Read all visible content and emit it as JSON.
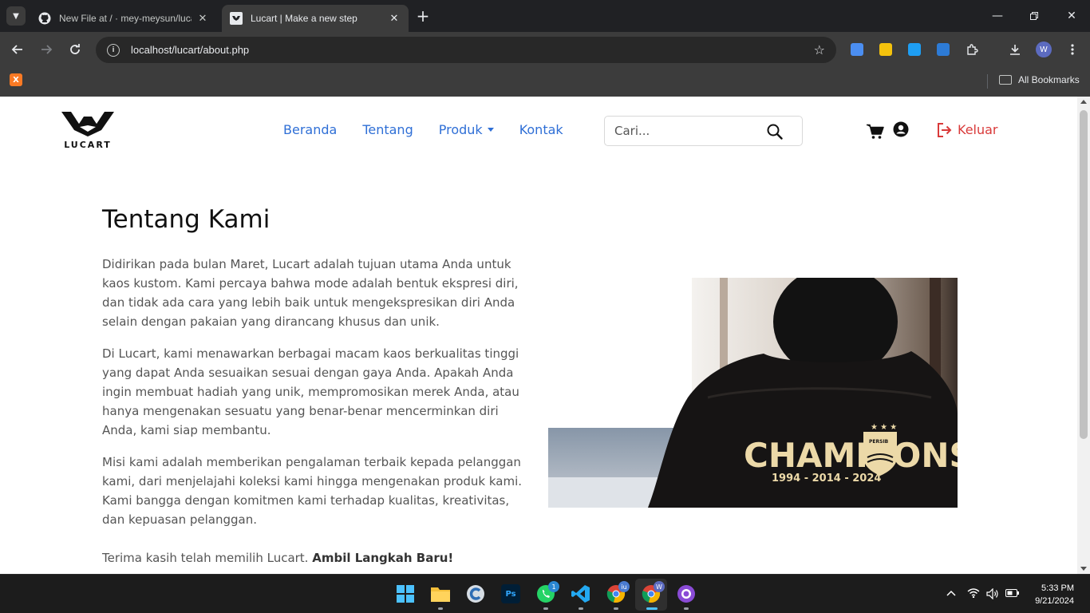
{
  "browser": {
    "tabs": [
      {
        "title": "New File at / · mey-meysun/lucart",
        "active": false
      },
      {
        "title": "Lucart | Make a new step",
        "active": true
      }
    ],
    "url": "localhost/lucart/about.php",
    "bookmarks_label": "All Bookmarks",
    "profile_initial": "W"
  },
  "site": {
    "logo_text": "LUCART",
    "nav": {
      "home": "Beranda",
      "about": "Tentang",
      "products": "Produk",
      "contact": "Kontak"
    },
    "search_placeholder": "Cari...",
    "logout_label": "Keluar"
  },
  "about": {
    "title": "Tentang Kami",
    "paragraphs": [
      "Didirikan pada bulan Maret, Lucart adalah tujuan utama Anda untuk kaos kustom. Kami percaya bahwa mode adalah bentuk ekspresi diri, dan tidak ada cara yang lebih baik untuk mengekspresikan diri Anda selain dengan pakaian yang dirancang khusus dan unik.",
      "Di Lucart, kami menawarkan berbagai macam kaos berkualitas tinggi yang dapat Anda sesuaikan sesuai dengan gaya Anda. Apakah Anda ingin membuat hadiah yang unik, mempromosikan merek Anda, atau hanya mengenakan sesuatu yang benar-benar mencerminkan diri Anda, kami siap membantu.",
      "Misi kami adalah memberikan pengalaman terbaik kepada pelanggan kami, dari menjelajahi koleksi kami hingga mengenakan produk kami. Kami bangga dengan komitmen kami terhadap kualitas, kreativitas, dan kepuasan pelanggan."
    ],
    "closing_text": "Terima kasih telah memilih Lucart. ",
    "closing_bold": "Ambil Langkah Baru!",
    "image": {
      "shirt_text": "CHAMPIONS",
      "shirt_years": "1994 - 2014 - 2024",
      "badge_text": "PERSIB"
    }
  },
  "taskbar": {
    "time": "5:33 PM",
    "date": "9/21/2024",
    "whatsapp_badge": "1",
    "chrome_badge": "iu"
  },
  "colors": {
    "nav_link": "#2f6fd6",
    "logout": "#d93a3a"
  }
}
